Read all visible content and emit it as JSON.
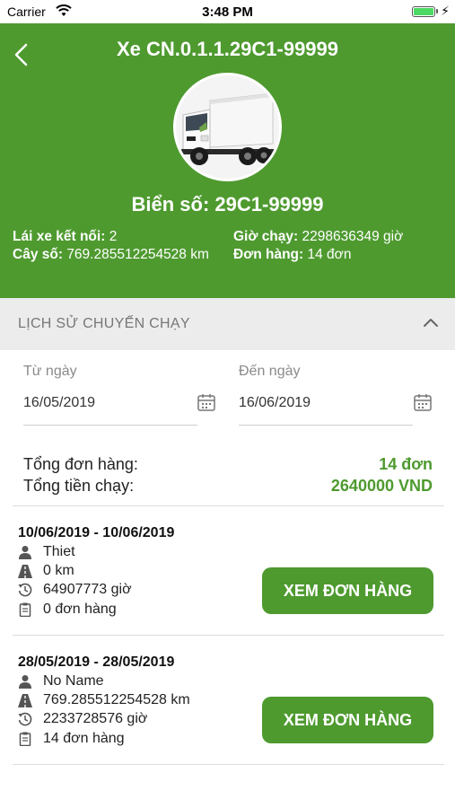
{
  "status_bar": {
    "carrier": "Carrier",
    "time": "3:48 PM"
  },
  "header": {
    "title": "Xe CN.0.1.1.29C1-99999",
    "plate": "Biển số: 29C1-99999",
    "driver_label": "Lái xe kết nối:",
    "driver_value": "2",
    "odometer_label": "Cây số:",
    "odometer_value": "769.285512254528 km",
    "hours_label": "Giờ chạy:",
    "hours_value": "2298636349 giờ",
    "orders_label": "Đơn hàng:",
    "orders_value": "14 đơn"
  },
  "section": {
    "title": "LỊCH SỬ CHUYẾN CHẠY"
  },
  "filter": {
    "from_label": "Từ ngày",
    "from_value": "16/05/2019",
    "to_label": "Đến ngày",
    "to_value": "16/06/2019"
  },
  "summary": {
    "total_orders_label": "Tổng đơn hàng:",
    "total_orders_value": "14 đơn",
    "total_amount_label": "Tổng tiền chạy:",
    "total_amount_value": "2640000 VND"
  },
  "trips": [
    {
      "date_range": "10/06/2019 - 10/06/2019",
      "driver": "Thiet",
      "distance": "0 km",
      "hours": "64907773 giờ",
      "orders": "0 đơn hàng",
      "button_label": "XEM ĐƠN HÀNG"
    },
    {
      "date_range": "28/05/2019 - 28/05/2019",
      "driver": "No Name",
      "distance": "769.285512254528 km",
      "hours": "2233728576 giờ",
      "orders": "14 đơn hàng",
      "button_label": "XEM ĐƠN HÀNG"
    }
  ],
  "colors": {
    "brand_green": "#4e9a2f",
    "section_bg": "#ececec"
  },
  "icons": [
    "wifi-icon",
    "battery-icon",
    "back-arrow-icon",
    "truck-image",
    "chevron-up-icon",
    "calendar-icon",
    "person-icon",
    "road-icon",
    "history-icon",
    "clipboard-icon"
  ]
}
